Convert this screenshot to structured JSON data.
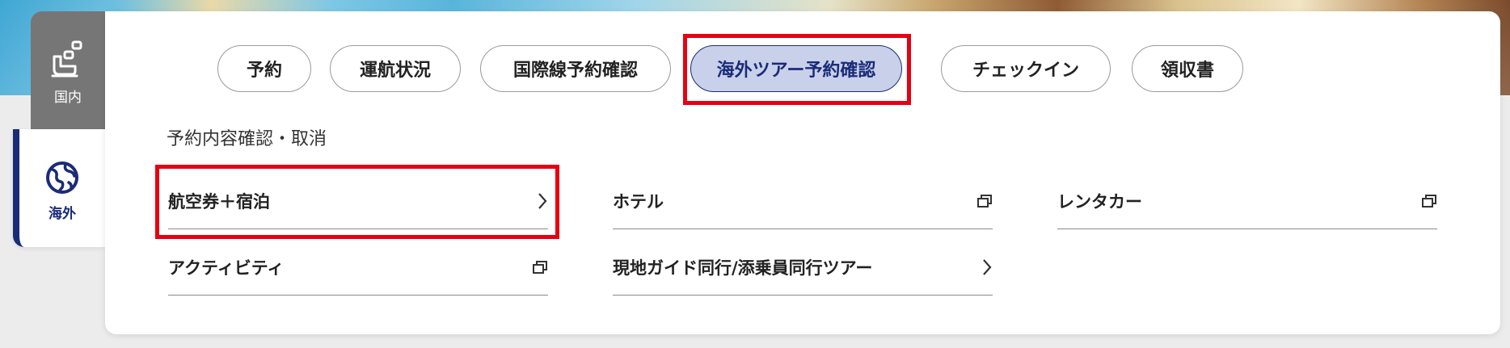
{
  "sidebar": {
    "domestic_label": "国内",
    "international_label": "海外",
    "active": "海外"
  },
  "tabs": [
    {
      "label": "予約",
      "active": false
    },
    {
      "label": "運航状況",
      "active": false
    },
    {
      "label": "国際線予約確認",
      "active": false
    },
    {
      "label": "海外ツアー予約確認",
      "active": true
    },
    {
      "label": "チェックイン",
      "active": false
    },
    {
      "label": "領収書",
      "active": false
    }
  ],
  "section": {
    "title": "予約内容確認・取消",
    "items": [
      {
        "label": "航空券＋宿泊",
        "icon": "chevron-right-icon"
      },
      {
        "label": "ホテル",
        "icon": "external-window-icon"
      },
      {
        "label": "レンタカー",
        "icon": "external-window-icon"
      },
      {
        "label": "アクティビティ",
        "icon": "external-window-icon"
      },
      {
        "label": "現地ガイド同行/添乗員同行ツアー",
        "icon": "chevron-right-icon"
      }
    ]
  },
  "colors": {
    "accent": "#1a2b78",
    "highlight": "#e60012",
    "active_tab_bg": "#c9d0ea",
    "sidebar_inactive": "#767676"
  }
}
